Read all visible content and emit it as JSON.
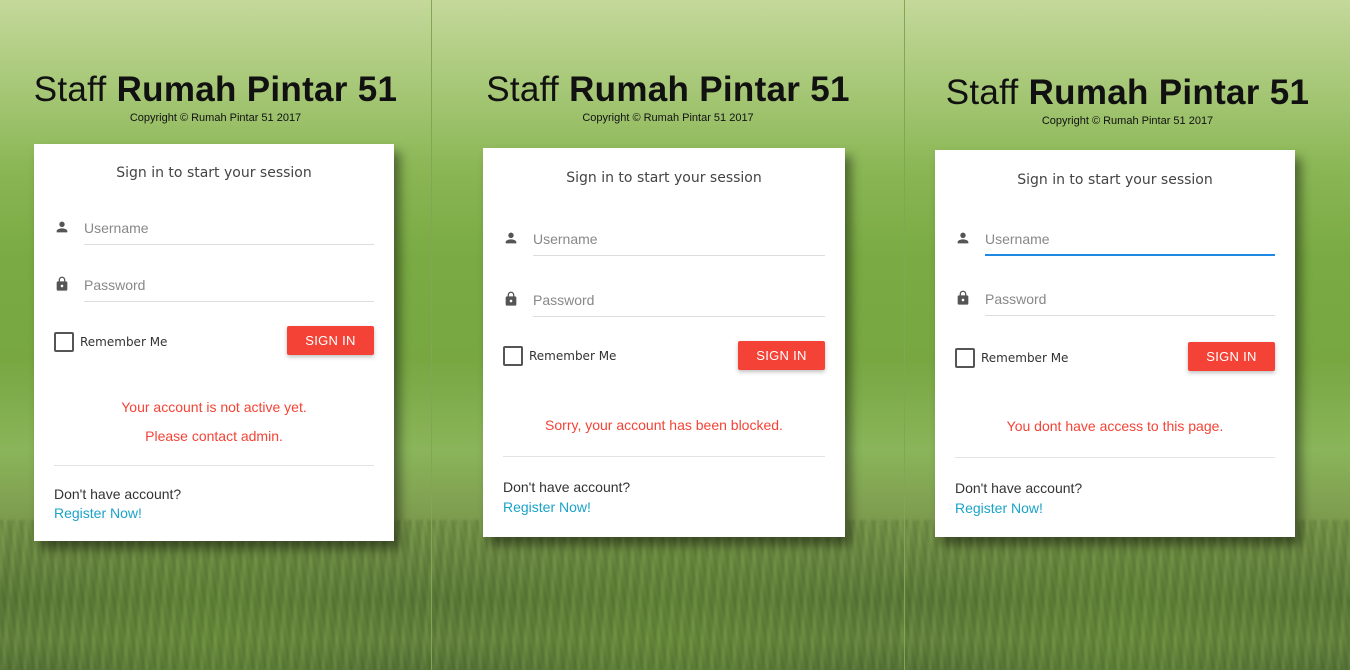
{
  "panels": [
    {
      "title_light": "Staff",
      "title_bold": "Rumah Pintar 51",
      "copyright": "Copyright © Rumah Pintar 51 2017",
      "session_msg": "Sign in to start your session",
      "username_placeholder": "Username",
      "password_placeholder": "Password",
      "remember_label": "Remember Me",
      "signin_label": "SIGN IN",
      "errors": [
        "Your account is not active yet.",
        "Please contact admin."
      ],
      "no_account_text": "Don't have account?",
      "register_label": "Register Now!"
    },
    {
      "title_light": "Staff",
      "title_bold": "Rumah Pintar 51",
      "copyright": "Copyright © Rumah Pintar 51 2017",
      "session_msg": "Sign in to start your session",
      "username_placeholder": "Username",
      "password_placeholder": "Password",
      "remember_label": "Remember Me",
      "signin_label": "SIGN IN",
      "errors": [
        "Sorry, your account has been blocked."
      ],
      "no_account_text": "Don't have account?",
      "register_label": "Register Now!"
    },
    {
      "title_light": "Staff",
      "title_bold": "Rumah Pintar 51",
      "copyright": "Copyright © Rumah Pintar 51 2017",
      "session_msg": "Sign in to start your session",
      "username_placeholder": "Username",
      "password_placeholder": "Password",
      "remember_label": "Remember Me",
      "signin_label": "SIGN IN",
      "errors": [
        "You dont have access to this page."
      ],
      "no_account_text": "Don't have account?",
      "register_label": "Register Now!"
    }
  ],
  "icons": {
    "username": "person-icon",
    "password": "lock-icon"
  },
  "colors": {
    "accent": "#f44336",
    "link": "#1aa3c8",
    "focus": "#1e88e5"
  }
}
